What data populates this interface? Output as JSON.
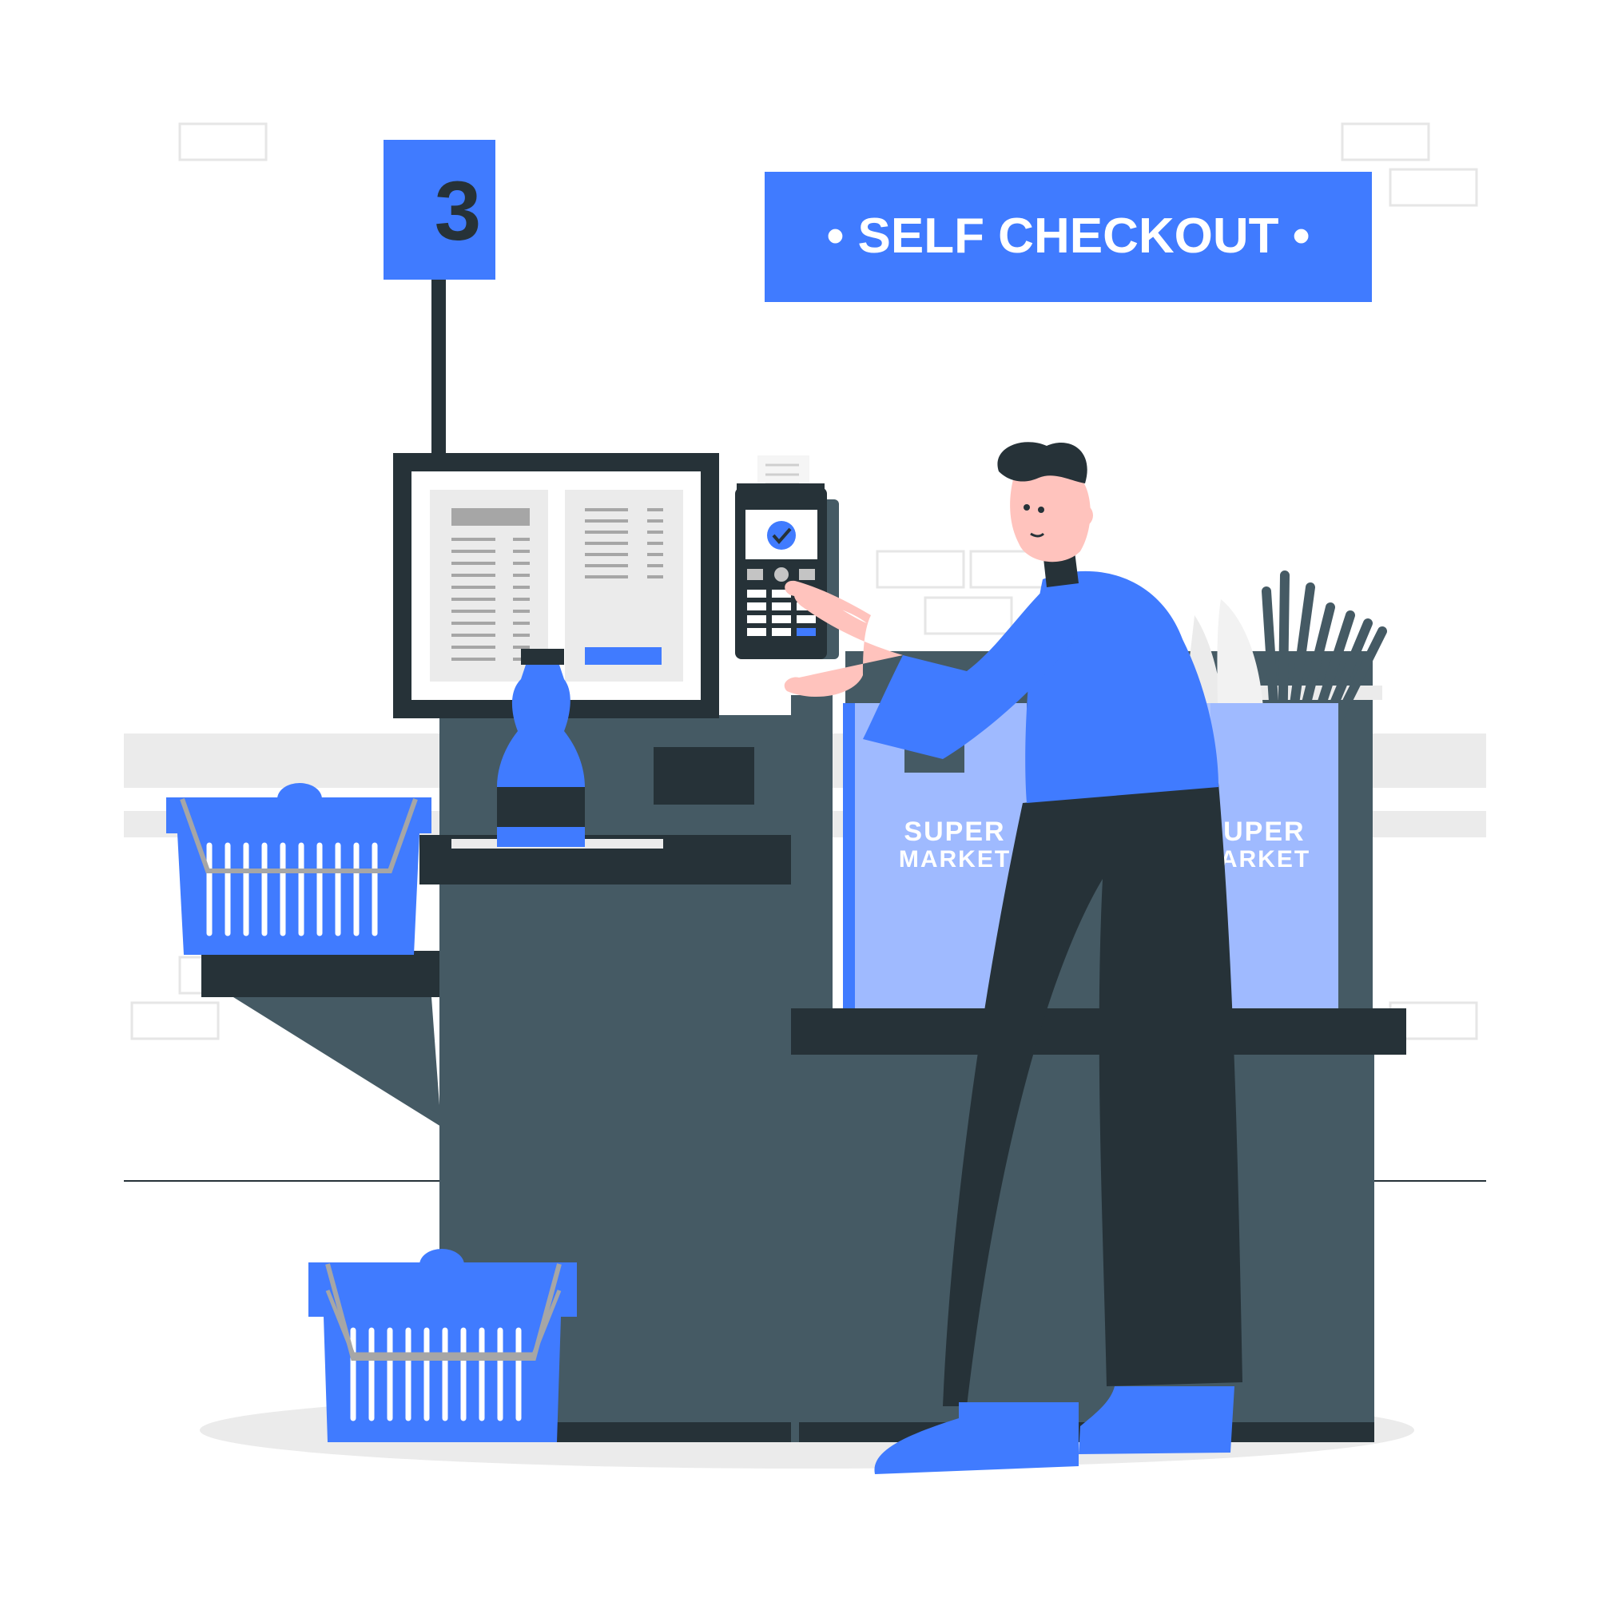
{
  "lane_sign": {
    "number": "3"
  },
  "banner": {
    "text": "• SELF CHECKOUT •"
  },
  "bag_front": {
    "line1": "SUPER",
    "line2": "MARKET"
  },
  "bag_back": {
    "line1": "SUPER",
    "line2": "MARKET"
  },
  "terminal": {
    "status_icon": "check-circle-icon"
  },
  "colors": {
    "accent": "#407BFF",
    "accent_light": "#9FBAFF",
    "dark": "#263238",
    "machine": "#455A64",
    "skin": "#FFC3BD"
  }
}
